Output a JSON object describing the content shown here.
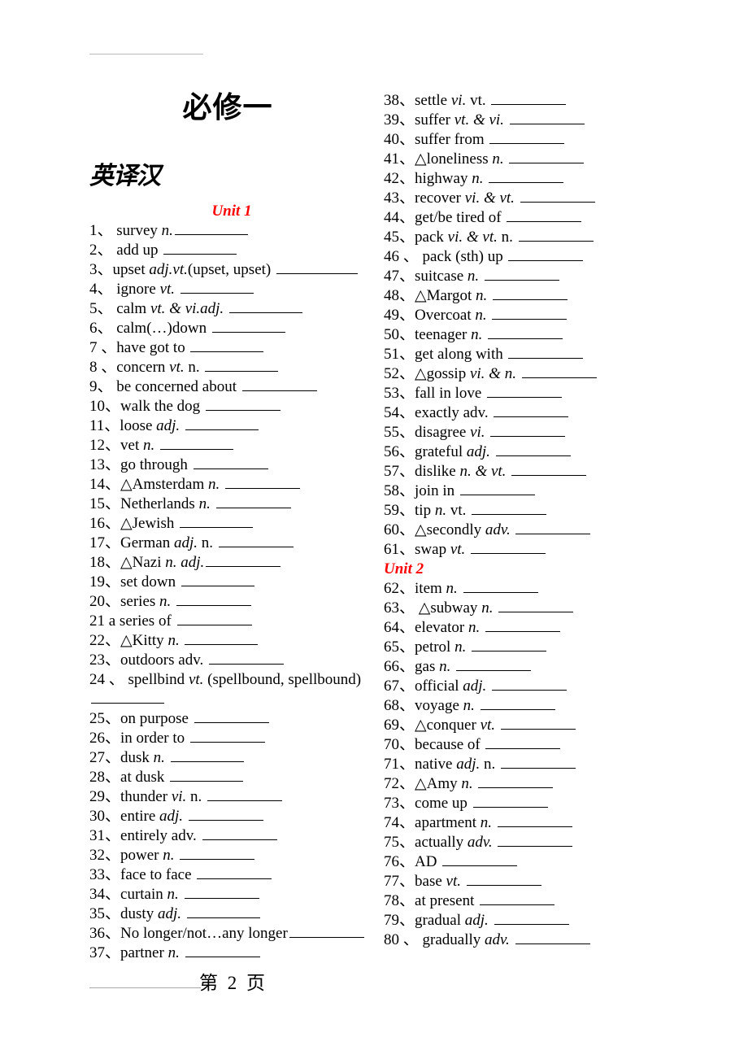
{
  "document": {
    "title": "必修一",
    "section_title": "英译汉",
    "page_label": "第 2 页"
  },
  "columns": {
    "left": {
      "unit_heading": "Unit 1",
      "entries": [
        {
          "num": "1、",
          "pre": "  survey ",
          "pos": "n.",
          "post": "",
          "blank": 90,
          "indent": 0
        },
        {
          "num": "2、",
          "pre": "  add up ",
          "pos": "",
          "post": "",
          "blank": 90,
          "indent": 0
        },
        {
          "num": "3、",
          "pre": "upset ",
          "pos": "adj.vt.",
          "post": "(upset, upset) ",
          "blank": 100,
          "indent": 0
        },
        {
          "num": "4、",
          "pre": "  ignore ",
          "pos": "vt.",
          "post": " ",
          "blank": 90,
          "indent": 0
        },
        {
          "num": "5、",
          "pre": "   calm ",
          "pos": "vt. & vi.adj.",
          "post": " ",
          "blank": 90,
          "indent": 0
        },
        {
          "num": "6、",
          "pre": "  calm(…)down ",
          "pos": "",
          "post": "",
          "blank": 90,
          "indent": 0
        },
        {
          "num": "7 、",
          "pre": "have got to ",
          "pos": "",
          "post": "",
          "blank": 90,
          "indent": 0
        },
        {
          "num": "8 、",
          "pre": "concern ",
          "pos": "vt.",
          "post": "      n. ",
          "blank": 90,
          "indent": 0
        },
        {
          "num": "9、",
          "pre": "  be concerned about ",
          "pos": "",
          "post": "",
          "blank": 92,
          "indent": 0
        },
        {
          "num": "10、",
          "pre": "walk the dog ",
          "pos": "",
          "post": "",
          "blank": 92,
          "indent": 0
        },
        {
          "num": "11、",
          "pre": "loose ",
          "pos": "adj.",
          "post": " ",
          "blank": 90,
          "indent": 0
        },
        {
          "num": "12、",
          "pre": "vet ",
          "pos": "n.",
          "post": " ",
          "blank": 90,
          "indent": 0
        },
        {
          "num": "13、",
          "pre": "go through ",
          "pos": "",
          "post": "",
          "blank": 92,
          "indent": 0
        },
        {
          "num": "14、",
          "pre": "△Amsterdam ",
          "pos": "n.",
          "post": " ",
          "blank": 92,
          "indent": 0
        },
        {
          "num": "15、",
          "pre": "Netherlands ",
          "pos": "n.",
          "post": " ",
          "blank": 92,
          "indent": 0
        },
        {
          "num": "16、",
          "pre": "△Jewish ",
          "pos": "",
          "post": "",
          "blank": 90,
          "indent": 0
        },
        {
          "num": "17、",
          "pre": "German ",
          "pos": "adj.",
          "post": "   n.    ",
          "blank": 92,
          "indent": 0
        },
        {
          "num": "18、",
          "pre": "△Nazi ",
          "pos": "n.",
          "post": "    ",
          "blank": 0,
          "indent": 0,
          "pos2": "adj.",
          "blank2": 92
        },
        {
          "num": "19、",
          "pre": "set down ",
          "pos": "",
          "post": "",
          "blank": 90,
          "indent": 0
        },
        {
          "num": "20、",
          "pre": "series ",
          "pos": "n.",
          "post": " ",
          "blank": 92,
          "indent": 0
        },
        {
          "num": "21",
          "pre": "    a series of ",
          "pos": "",
          "post": "",
          "blank": 92,
          "indent": 0
        },
        {
          "num": "22、",
          "pre": "△Kitty ",
          "pos": "n.",
          "post": " ",
          "blank": 90,
          "indent": 0
        },
        {
          "num": "23、",
          "pre": "outdoors adv. ",
          "pos": "",
          "post": "",
          "blank": 92,
          "indent": 0
        },
        {
          "num": "24 、",
          "pre": "  spellbind  ",
          "pos": "vt.",
          "post": "  (spellbound,  spellbound)",
          "blank": 0,
          "indent": 0,
          "wrapblank": 90
        },
        {
          "num": "25、",
          "pre": "on purpose ",
          "pos": "",
          "post": "",
          "blank": 92,
          "indent": 0
        },
        {
          "num": "26、",
          "pre": "in order to ",
          "pos": "",
          "post": "",
          "blank": 92,
          "indent": 0
        },
        {
          "num": "27、",
          "pre": "dusk ",
          "pos": "n.",
          "post": " ",
          "blank": 90,
          "indent": 0
        },
        {
          "num": "28、",
          "pre": "at dusk ",
          "pos": "",
          "post": "",
          "blank": 90,
          "indent": 0
        },
        {
          "num": "29、",
          "pre": "thunder ",
          "pos": "vi.",
          "post": "   n.     ",
          "blank": 92,
          "indent": 0
        },
        {
          "num": "30、",
          "pre": "entire ",
          "pos": "adj.",
          "post": " ",
          "blank": 92,
          "indent": 0
        },
        {
          "num": "31、",
          "pre": "entirely adv. ",
          "pos": "",
          "post": "",
          "blank": 92,
          "indent": 0
        },
        {
          "num": "32、",
          "pre": "power ",
          "pos": "n.",
          "post": " ",
          "blank": 92,
          "indent": 0
        },
        {
          "num": "33、",
          "pre": "face to face ",
          "pos": "",
          "post": "",
          "blank": 92,
          "indent": 0
        },
        {
          "num": "34、",
          "pre": "curtain ",
          "pos": "n.",
          "post": " ",
          "blank": 92,
          "indent": 0
        },
        {
          "num": "35、",
          "pre": "dusty ",
          "pos": "adj.",
          "post": " ",
          "blank": 90,
          "indent": 0
        },
        {
          "num": "36、",
          "pre": "No longer/not…any longer",
          "pos": "",
          "post": "",
          "blank": 92,
          "indent": 0
        },
        {
          "num": "37、",
          "pre": "partner ",
          "pos": "n.",
          "post": " ",
          "blank": 92,
          "indent": 0
        }
      ]
    },
    "right": {
      "unit_heading": "Unit 2",
      "unit_heading_after_index": 24,
      "entries": [
        {
          "num": "38、",
          "pre": "settle ",
          "pos": "vi.",
          "post": "    vt. ",
          "blank": 92
        },
        {
          "num": "39、",
          "pre": "suffer ",
          "pos": "vt. & vi.",
          "post": " ",
          "blank": 92
        },
        {
          "num": "40、",
          "pre": "suffer from ",
          "pos": "",
          "post": "",
          "blank": 92
        },
        {
          "num": "41、",
          "pre": "△loneliness ",
          "pos": "n.",
          "post": " ",
          "blank": 92
        },
        {
          "num": "42、",
          "pre": "highway ",
          "pos": "n.",
          "post": " ",
          "blank": 92
        },
        {
          "num": "43、",
          "pre": "recover ",
          "pos": "vi. & vt.",
          "post": " ",
          "blank": 92
        },
        {
          "num": "44、",
          "pre": "get/be tired of ",
          "pos": "",
          "post": "",
          "blank": 92
        },
        {
          "num": "45、",
          "pre": "pack ",
          "pos": "vi. & vt.",
          "post": "     n. ",
          "blank": 92
        },
        {
          "num": "46 、",
          "pre": " pack (sth) up ",
          "pos": "",
          "post": "",
          "blank": 92
        },
        {
          "num": "47、",
          "pre": "suitcase ",
          "pos": "n.",
          "post": " ",
          "blank": 92
        },
        {
          "num": "48、",
          "pre": "△Margot ",
          "pos": "n.",
          "post": " ",
          "blank": 92
        },
        {
          "num": "49、",
          "pre": "Overcoat ",
          "pos": "n.",
          "post": " ",
          "blank": 92
        },
        {
          "num": "50、",
          "pre": "teenager ",
          "pos": "n.",
          "post": " ",
          "blank": 92
        },
        {
          "num": "51、",
          "pre": "get along with ",
          "pos": "",
          "post": "",
          "blank": 92
        },
        {
          "num": "52、",
          "pre": "△gossip ",
          "pos": "vi. & n.",
          "post": " ",
          "blank": 92
        },
        {
          "num": "53、",
          "pre": "fall in love ",
          "pos": "",
          "post": "",
          "blank": 92
        },
        {
          "num": "54、",
          "pre": "exactly adv. ",
          "pos": "",
          "post": "",
          "blank": 92
        },
        {
          "num": "55、",
          "pre": "disagree ",
          "pos": "vi.",
          "post": " ",
          "blank": 92
        },
        {
          "num": "56、",
          "pre": "grateful ",
          "pos": "adj.",
          "post": " ",
          "blank": 92
        },
        {
          "num": "57、",
          "pre": "dislike ",
          "pos": "n. & vt.",
          "post": " ",
          "blank": 92
        },
        {
          "num": "58、",
          "pre": "join in ",
          "pos": "",
          "post": "",
          "blank": 92
        },
        {
          "num": "59、",
          "pre": "tip ",
          "pos": "n.",
          "post": "     vt. ",
          "blank": 92
        },
        {
          "num": "60、",
          "pre": "△secondly ",
          "pos": "adv.",
          "post": " ",
          "blank": 92
        },
        {
          "num": "61、",
          "pre": "swap ",
          "pos": "vt.",
          "post": " ",
          "blank": 92
        },
        {
          "num": "62、",
          "pre": "item ",
          "pos": "n.",
          "post": " ",
          "blank": 92
        },
        {
          "num": "63、",
          "pre": "   △subway   ",
          "pos": "n.",
          "post": " ",
          "blank": 92
        },
        {
          "num": "64、",
          "pre": "elevator ",
          "pos": "n.",
          "post": " ",
          "blank": 92
        },
        {
          "num": "65、",
          "pre": "petrol   ",
          "pos": "n.",
          "post": " ",
          "blank": 92
        },
        {
          "num": "66、",
          "pre": "gas ",
          "pos": "n.",
          "post": " ",
          "blank": 92
        },
        {
          "num": "67、",
          "pre": "official ",
          "pos": "adj.",
          "post": " ",
          "blank": 92
        },
        {
          "num": "68、",
          "pre": "voyage ",
          "pos": "n.",
          "post": " ",
          "blank": 92
        },
        {
          "num": "69、",
          "pre": "△conquer ",
          "pos": "vt.",
          "post": " ",
          "blank": 92
        },
        {
          "num": "70、",
          "pre": "because of ",
          "pos": "",
          "post": "",
          "blank": 92
        },
        {
          "num": "71、",
          "pre": "native ",
          "pos": "adj.",
          "post": "     n. ",
          "blank": 92
        },
        {
          "num": "72、",
          "pre": "△Amy ",
          "pos": "n.",
          "post": " ",
          "blank": 92
        },
        {
          "num": "73、",
          "pre": "come up ",
          "pos": "",
          "post": "",
          "blank": 92
        },
        {
          "num": "74、",
          "pre": "apartment ",
          "pos": "n.",
          "post": " ",
          "blank": 92
        },
        {
          "num": "75、",
          "pre": "actually ",
          "pos": "adv.",
          "post": " ",
          "blank": 92
        },
        {
          "num": "76、",
          "pre": "AD ",
          "pos": "",
          "post": "",
          "blank": 92
        },
        {
          "num": "77、",
          "pre": "base ",
          "pos": "vt.",
          "post": " ",
          "blank": 92
        },
        {
          "num": "78、",
          "pre": "at present ",
          "pos": "",
          "post": "",
          "blank": 92
        },
        {
          "num": "79、",
          "pre": "gradual ",
          "pos": "adj.",
          "post": " ",
          "blank": 92
        },
        {
          "num": "80 、",
          "pre": " gradually ",
          "pos": "adv.",
          "post": " ",
          "blank": 92
        }
      ]
    }
  }
}
